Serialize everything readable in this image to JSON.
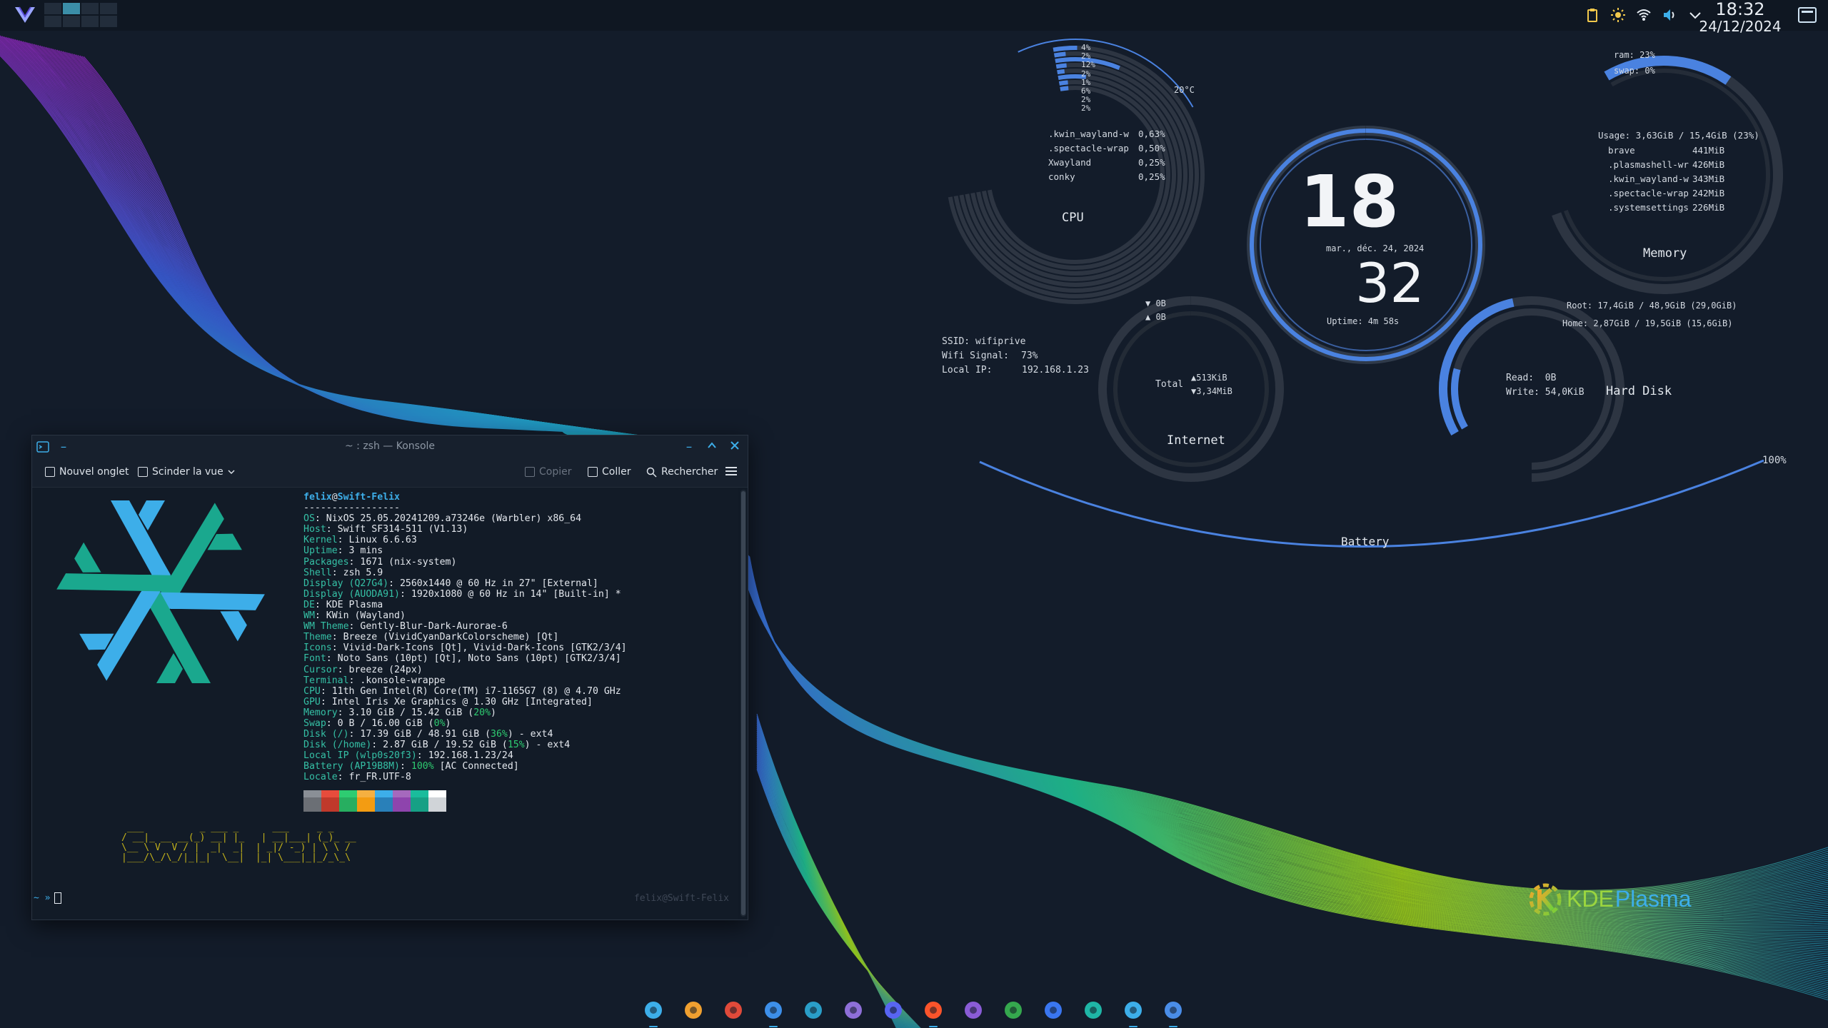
{
  "top_panel": {
    "clock_time": "18:32",
    "clock_date": "24/12/2024",
    "pager_active_index": 1,
    "tray_icons": [
      "clipboard-icon",
      "brightness-icon",
      "wifi-icon",
      "volume-icon",
      "tray-expand-icon"
    ]
  },
  "conky": {
    "cpu": {
      "label": "CPU",
      "core_loads": [
        "4%",
        "2%",
        "12%",
        "2%",
        "1%",
        "6%",
        "2%",
        "2%"
      ],
      "temperature": "20°C",
      "top_processes": [
        {
          "name": ".kwin_wayland-w",
          "value": "0,63%"
        },
        {
          "name": ".spectacle-wrap",
          "value": "0,50%"
        },
        {
          "name": "Xwayland",
          "value": "0,25%"
        },
        {
          "name": "conky",
          "value": "0,25%"
        }
      ]
    },
    "clock": {
      "hour": "18",
      "minute": "32",
      "date": "mar., déc. 24, 2024",
      "uptime": "Uptime: 4m 58s"
    },
    "memory": {
      "label": "Memory",
      "ram": "ram: 23%",
      "swap": "swap: 0%",
      "usage": "Usage: 3,63GiB / 15,4GiB (23%)",
      "ram_fraction": 0.23,
      "top_processes": [
        {
          "name": "brave",
          "value": "441MiB"
        },
        {
          "name": ".plasmashell-wr",
          "value": "426MiB"
        },
        {
          "name": ".kwin_wayland-w",
          "value": "343MiB"
        },
        {
          "name": ".spectacle-wrap",
          "value": "242MiB"
        },
        {
          "name": ".systemsettings",
          "value": "226MiB"
        }
      ]
    },
    "network": {
      "ssid": "SSID: wifiprive",
      "signal_label": "Wifi Signal:",
      "signal_value": "73%",
      "ip_label": "Local IP:",
      "ip_value": "192.168.1.23",
      "down_rate": "▼ 0B",
      "up_rate": "▲ 0B",
      "total_label": "Total",
      "total_up": "▲513KiB",
      "total_down": "▼3,34MiB",
      "label": "Internet"
    },
    "disk": {
      "root": "Root: 17,4GiB / 48,9GiB (29,0GiB)",
      "home": "Home: 2,87GiB / 19,5GiB (15,6GiB)",
      "read": "Read:  0B",
      "write": "Write: 54,0KiB",
      "label": "Hard Disk",
      "root_fraction": 0.36,
      "home_fraction": 0.15
    },
    "battery": {
      "label": "Battery",
      "percent": "100%",
      "fraction": 1.0
    }
  },
  "konsole": {
    "title": "~ : zsh — Konsole",
    "toolbar": {
      "new_tab": "Nouvel onglet",
      "split_view": "Scinder la vue",
      "copy": "Copier",
      "paste": "Coller",
      "search": "Rechercher"
    },
    "fetch": {
      "user": "felix",
      "at": "@",
      "host": "Swift-Felix",
      "separator": "-----------------",
      "lines": [
        {
          "key": "OS",
          "value": "NixOS 25.05.20241209.a73246e (Warbler) x86_64"
        },
        {
          "key": "Host",
          "value": "Swift SF314-511 (V1.13)"
        },
        {
          "key": "Kernel",
          "value": "Linux 6.6.63"
        },
        {
          "key": "Uptime",
          "value": "3 mins"
        },
        {
          "key": "Packages",
          "value": "1671 (nix-system)"
        },
        {
          "key": "Shell",
          "value": "zsh 5.9"
        },
        {
          "key": "Display (Q27G4)",
          "value": "2560x1440 @ 60 Hz in 27\" [External]"
        },
        {
          "key": "Display (AUODA91)",
          "value": "1920x1080 @ 60 Hz in 14\" [Built-in] *"
        },
        {
          "key": "DE",
          "value": "KDE Plasma"
        },
        {
          "key": "WM",
          "value": "KWin (Wayland)"
        },
        {
          "key": "WM Theme",
          "value": "Gently-Blur-Dark-Aurorae-6"
        },
        {
          "key": "Theme",
          "value": "Breeze (VividCyanDarkColorscheme) [Qt]"
        },
        {
          "key": "Icons",
          "value": "Vivid-Dark-Icons [Qt], Vivid-Dark-Icons [GTK2/3/4]"
        },
        {
          "key": "Font",
          "value": "Noto Sans (10pt) [Qt], Noto Sans (10pt) [GTK2/3/4]"
        },
        {
          "key": "Cursor",
          "value": "breeze (24px)"
        },
        {
          "key": "Terminal",
          "value": ".konsole-wrappe"
        },
        {
          "key": "CPU",
          "value": "11th Gen Intel(R) Core(TM) i7-1165G7 (8) @ 4.70 GHz"
        },
        {
          "key": "GPU",
          "value": "Intel Iris Xe Graphics @ 1.30 GHz [Integrated]"
        },
        {
          "key": "Memory",
          "value": "3.10 GiB / 15.42 GiB (",
          "hl": "20%",
          "after": ")"
        },
        {
          "key": "Swap",
          "value": "0 B / 16.00 GiB (",
          "hl": "0%",
          "after": ")"
        },
        {
          "key": "Disk (/)",
          "value": "17.39 GiB / 48.91 GiB (",
          "hl": "36%",
          "after": ") - ext4"
        },
        {
          "key": "Disk (/home)",
          "value": "2.87 GiB / 19.52 GiB (",
          "hl": "15%",
          "after": ") - ext4"
        },
        {
          "key": "Local IP (wlp0s20f3)",
          "value": "192.168.1.23/24"
        },
        {
          "key": "Battery (AP19B8M)",
          "value": "",
          "hl": "100%",
          "after": " [AC Connected]"
        },
        {
          "key": "Locale",
          "value": "fr_FR.UTF-8"
        }
      ],
      "palette_top": [
        "#6b6f75",
        "#c0392b",
        "#27ae60",
        "#f39c12",
        "#2980b9",
        "#8e44ad",
        "#16a085",
        "#d0d4d8"
      ],
      "palette_bottom": [
        "#8a8f96",
        "#e74c3c",
        "#2ecc71",
        "#f5b041",
        "#3daee9",
        "#a569bd",
        "#1abc9c",
        "#ffffff"
      ]
    },
    "prompt_symbol": "~ »",
    "right_prompt": "felix@Swift-Felix"
  },
  "kde_logo": {
    "text_a": "KDE",
    "text_b": " Plasma"
  },
  "dock": {
    "apps": [
      {
        "name": "konsole-app-icon",
        "color": "#3daee9",
        "running": true
      },
      {
        "name": "firefox-app-icon",
        "color": "#f0a030",
        "running": false
      },
      {
        "name": "chrome-app-icon",
        "color": "#e04a3a",
        "running": false
      },
      {
        "name": "system-settings-app-icon",
        "color": "#3d8fe9",
        "running": true
      },
      {
        "name": "notes-app-icon",
        "color": "#2a9ec8",
        "running": false
      },
      {
        "name": "system-monitor-app-icon",
        "color": "#8e6fd8",
        "running": false
      },
      {
        "name": "discord-app-icon",
        "color": "#5865f2",
        "running": false
      },
      {
        "name": "brave-app-icon",
        "color": "#fb542b",
        "running": true
      },
      {
        "name": "vscode-app-icon",
        "color": "#8a5cd6",
        "running": false
      },
      {
        "name": "xbox-app-icon",
        "color": "#35a84e",
        "running": false
      },
      {
        "name": "signal-app-icon",
        "color": "#3a76f0",
        "running": false
      },
      {
        "name": "sync-app-icon",
        "color": "#1fb6a6",
        "running": false
      },
      {
        "name": "terminal-app-icon",
        "color": "#3daee9",
        "running": true
      },
      {
        "name": "spectacle-app-icon",
        "color": "#4a8de8",
        "running": true
      }
    ]
  }
}
